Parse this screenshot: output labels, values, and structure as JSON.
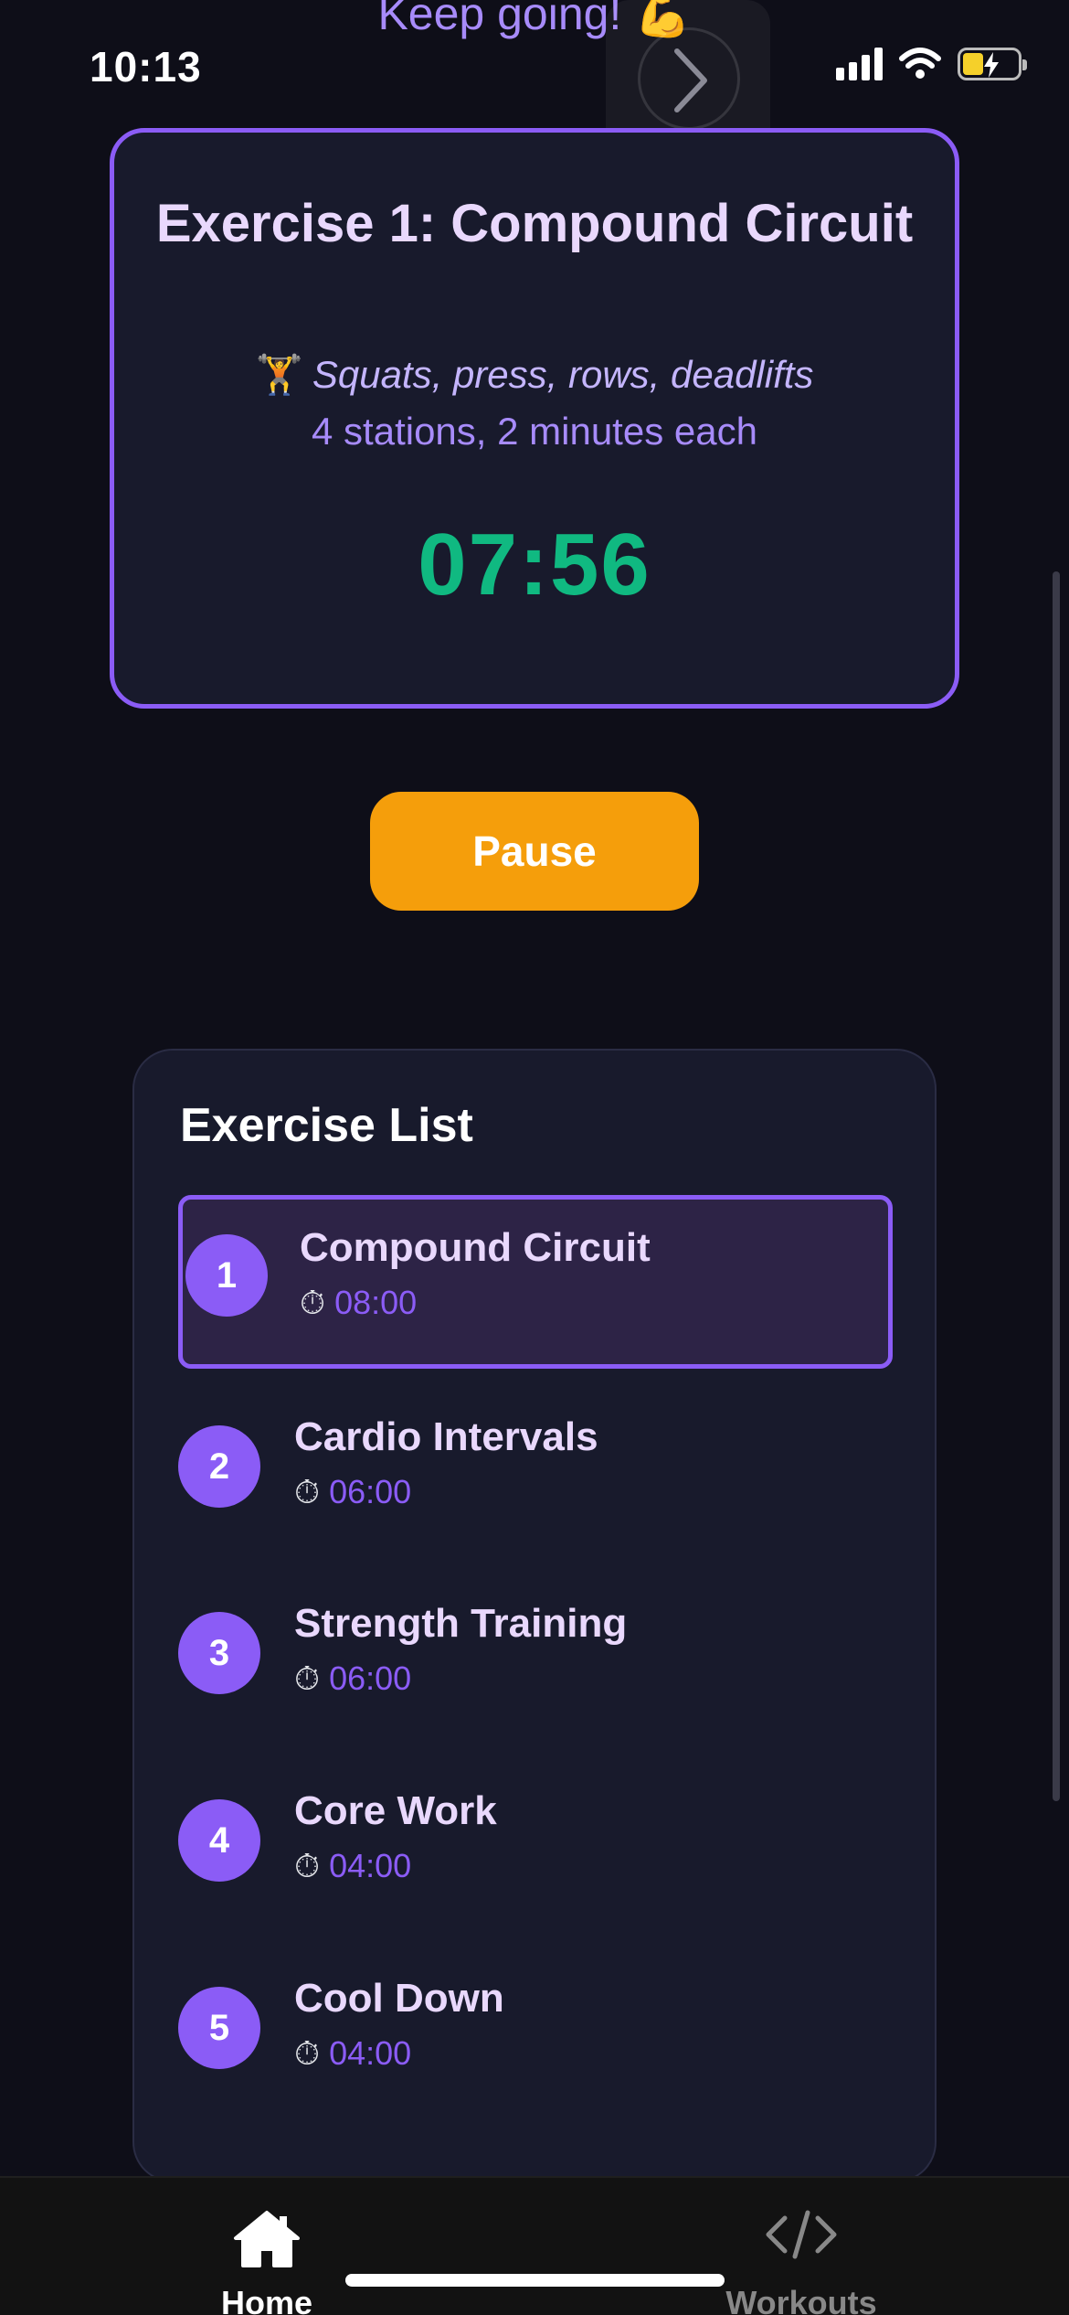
{
  "status_bar": {
    "time": "10:13",
    "icons": [
      "signal-icon",
      "wifi-icon",
      "battery-charging-icon"
    ]
  },
  "banner": {
    "text": "Keep going!",
    "emoji": "💪"
  },
  "forward_button": {
    "icon": "chevron-right-icon"
  },
  "current_exercise": {
    "title": "Exercise 1: Compound Circuit",
    "emoji": "🏋",
    "description": "Squats, press, rows, deadlifts",
    "detail": "4 stations, 2 minutes each",
    "timer": "07:56"
  },
  "controls": {
    "pause_label": "Pause"
  },
  "exercise_list": {
    "title": "Exercise List",
    "clock_emoji": "⏱",
    "items": [
      {
        "number": "1",
        "name": "Compound Circuit",
        "duration": "08:00",
        "active": true
      },
      {
        "number": "2",
        "name": "Cardio Intervals",
        "duration": "06:00",
        "active": false
      },
      {
        "number": "3",
        "name": "Strength Training",
        "duration": "06:00",
        "active": false
      },
      {
        "number": "4",
        "name": "Core Work",
        "duration": "04:00",
        "active": false
      },
      {
        "number": "5",
        "name": "Cool Down",
        "duration": "04:00",
        "active": false
      }
    ]
  },
  "tab_bar": {
    "tabs": [
      {
        "label": "Home",
        "icon": "home-icon",
        "active": true
      },
      {
        "label": "Workouts",
        "icon": "code-icon",
        "active": false
      }
    ]
  },
  "colors": {
    "background": "#0e0e18",
    "card": "#181a2c",
    "accent_purple": "#8b5cf6",
    "timer_green": "#10b981",
    "pause_orange": "#f59e0b"
  }
}
